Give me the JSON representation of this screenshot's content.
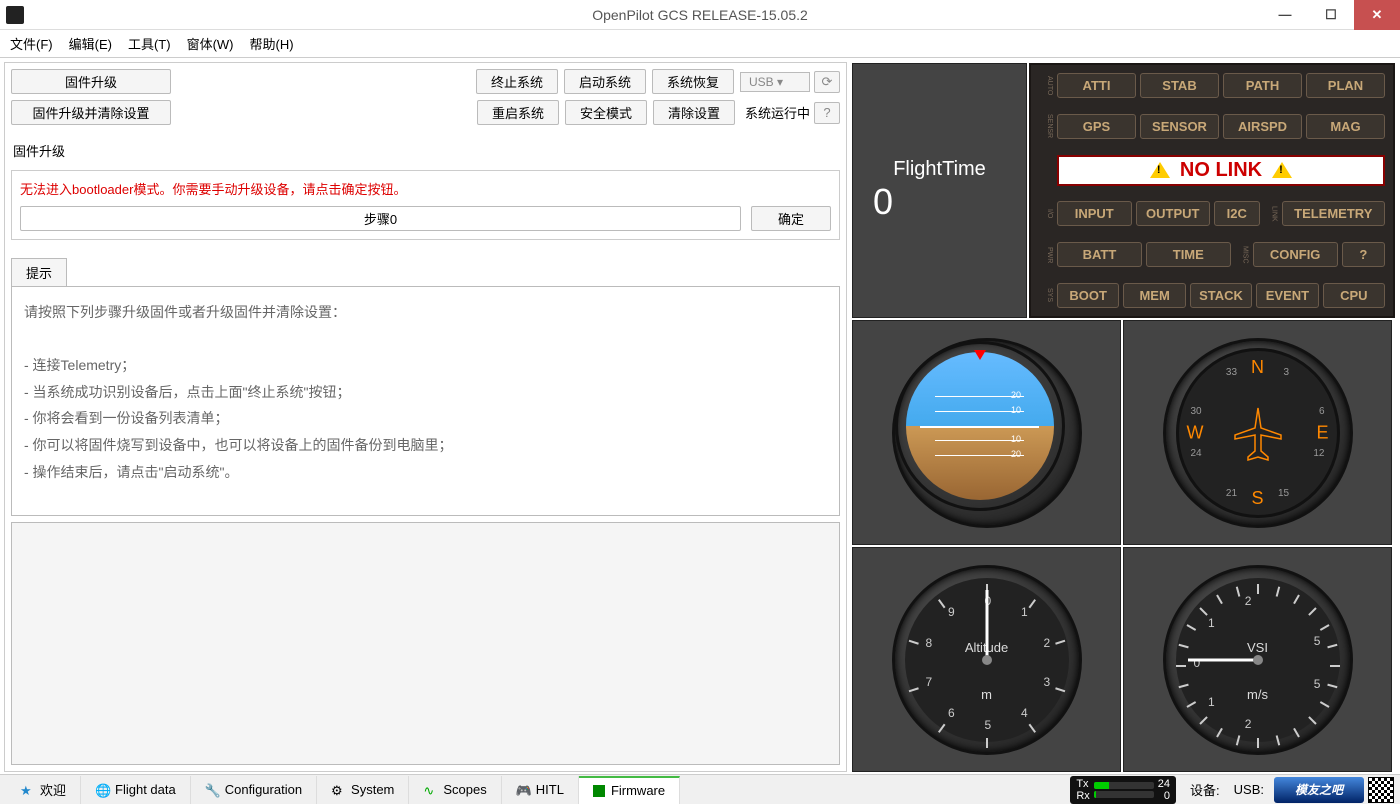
{
  "window": {
    "title": "OpenPilot GCS RELEASE-15.05.2"
  },
  "menu": [
    "文件(F)",
    "编辑(E)",
    "工具(T)",
    "窗体(W)",
    "帮助(H)"
  ],
  "toolbar": {
    "upgrade": "固件升级",
    "upgrade_clear": "固件升级并清除设置",
    "halt": "终止系统",
    "start": "启动系统",
    "recover": "系统恢复",
    "usb": "USB",
    "restart": "重启系统",
    "safe": "安全模式",
    "erase": "清除设置",
    "status": "系统运行中"
  },
  "section": {
    "label": "固件升级"
  },
  "error": {
    "msg": "无法进入bootloader模式。你需要手动升级设备，请点击确定按钮。",
    "step": "步骤0",
    "ok": "确定"
  },
  "tips": {
    "tab": "提示",
    "head": "请按照下列步骤升级固件或者升级固件并清除设置：",
    "l1": "- 连接Telemetry；",
    "l2": "- 当系统成功识别设备后，点击上面\"终止系统\"按钮；",
    "l3": "- 你将会看到一份设备列表清单；",
    "l4": "- 你可以将固件烧写到设备中，也可以将设备上的固件备份到电脑里；",
    "l5": "- 操作结束后，请点击\"启动系统\"。"
  },
  "flighttime": {
    "label": "FlightTime",
    "value": "0"
  },
  "sys": {
    "row1": [
      "ATTI",
      "STAB",
      "PATH",
      "PLAN"
    ],
    "row2": [
      "GPS",
      "SENSOR",
      "AIRSPD",
      "MAG"
    ],
    "nolink": "NO LINK",
    "row3a": [
      "INPUT",
      "OUTPUT",
      "I2C"
    ],
    "row3b": "TELEMETRY",
    "row4a": [
      "BATT",
      "TIME"
    ],
    "row4b": [
      "CONFIG",
      "?"
    ],
    "row5": [
      "BOOT",
      "MEM",
      "STACK",
      "EVENT",
      "CPU"
    ],
    "labels": {
      "r1": "AUTO",
      "r2": "SENSR",
      "r3": "I/O",
      "r3b": "LINK",
      "r4": "PWR",
      "r4b": "MISC",
      "r5": "SYS"
    }
  },
  "gauges": {
    "att_ticks": [
      "20",
      "10",
      "10",
      "20"
    ],
    "compass": {
      "n": "N",
      "e": "E",
      "s": "S",
      "w": "W",
      "nums": [
        "33",
        "3",
        "6",
        "12",
        "15",
        "21",
        "24",
        "30"
      ]
    },
    "alt": {
      "label": "Altitude",
      "unit": "m",
      "nums": [
        "0",
        "1",
        "2",
        "3",
        "4",
        "5",
        "6",
        "7",
        "8",
        "9"
      ]
    },
    "vsi": {
      "label": "VSI",
      "unit": "m/s",
      "nums": [
        "0",
        "1",
        "2",
        "5",
        "-1",
        "-2",
        "-5"
      ]
    }
  },
  "bottom": {
    "tabs": [
      {
        "icon": "star",
        "label": "欢迎"
      },
      {
        "icon": "globe",
        "label": "Flight data"
      },
      {
        "icon": "wrench",
        "label": "Configuration"
      },
      {
        "icon": "gear",
        "label": "System"
      },
      {
        "icon": "wave",
        "label": "Scopes"
      },
      {
        "icon": "joy",
        "label": "HITL"
      },
      {
        "icon": "chip",
        "label": "Firmware"
      }
    ],
    "tx": "Tx",
    "rx": "Rx",
    "txval": "24",
    "rxval": "0",
    "device": "设备:",
    "usb": "USB:",
    "logo": "模友之吧"
  }
}
